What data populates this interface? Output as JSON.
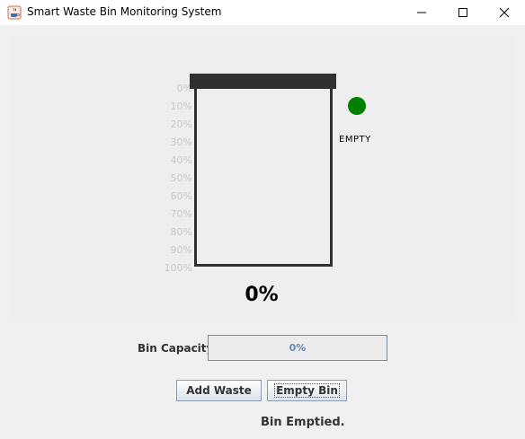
{
  "window": {
    "title": "Smart Waste Bin Monitoring System",
    "icon": "java-cup-icon",
    "controls": [
      "minimize-icon",
      "maximize-icon",
      "close-icon"
    ]
  },
  "bin": {
    "scale_ticks": [
      "0%",
      "10%",
      "20%",
      "30%",
      "40%",
      "50%",
      "60%",
      "70%",
      "80%",
      "90%",
      "100%"
    ],
    "fill_level": 0,
    "status_color": "#008000",
    "status_text": "EMPTY",
    "percent_display": "0%"
  },
  "capacity": {
    "label": "Bin Capacity:",
    "progress_value": 0,
    "progress_text": "0%"
  },
  "buttons": {
    "add_waste": "Add Waste",
    "empty_bin": "Empty Bin"
  },
  "status_message": "Bin Emptied."
}
